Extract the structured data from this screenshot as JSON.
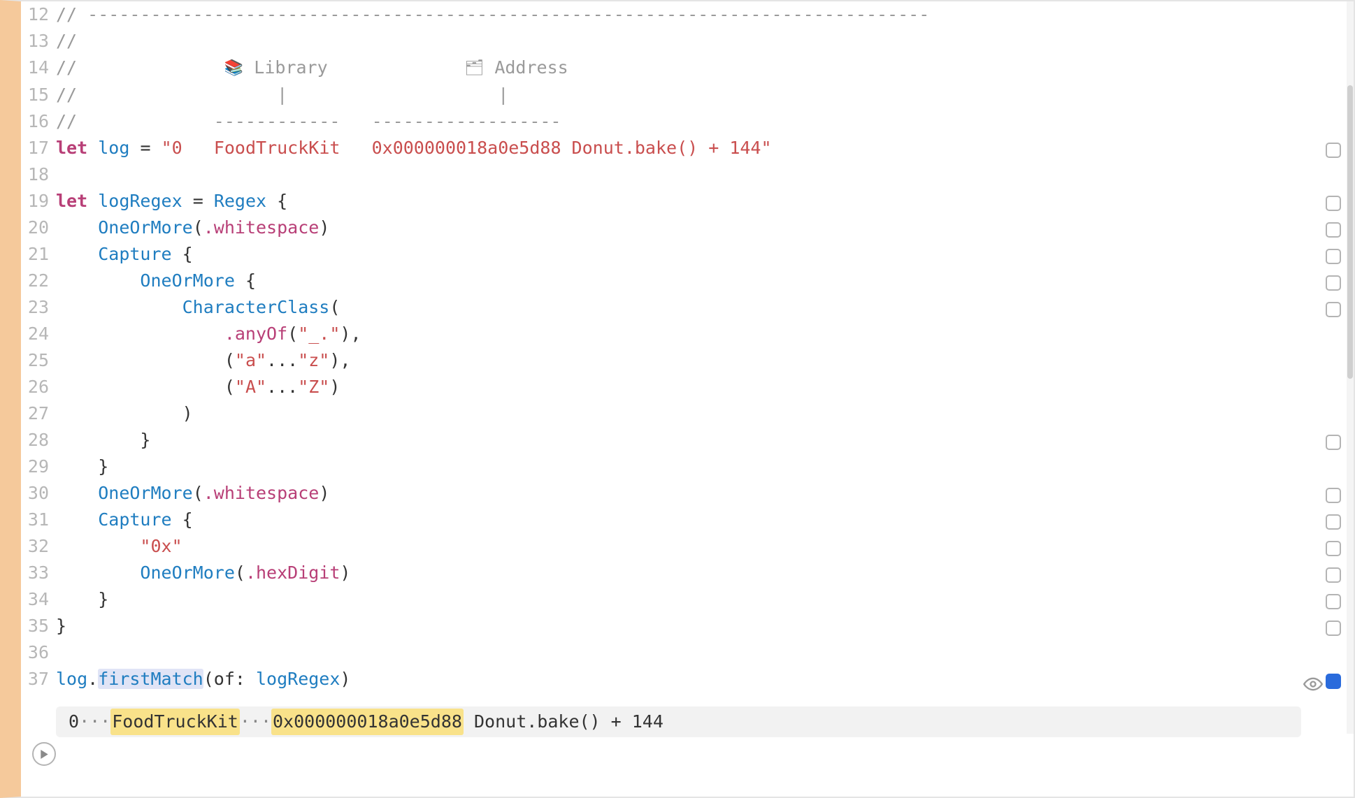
{
  "lines": {
    "12": {
      "n": "12",
      "comment_dashes": "// --------------------------------------------------------------------------------"
    },
    "13": {
      "n": "13",
      "slashes": "//"
    },
    "14": {
      "n": "14",
      "slashes": "//",
      "library_icon": "📚",
      "library": "Library",
      "address_icon": "🗂",
      "address": "Address"
    },
    "15": {
      "n": "15",
      "slashes": "//",
      "bar1": "|",
      "bar2": "|"
    },
    "16": {
      "n": "16",
      "slashes": "//",
      "dash1": "------------",
      "dash2": "------------------"
    },
    "17": {
      "n": "17",
      "let": "let",
      "name": "log",
      "eq": "=",
      "str": "\"0   FoodTruckKit   0x000000018a0e5d88 Donut.bake() + 144\""
    },
    "18": {
      "n": "18"
    },
    "19": {
      "n": "19",
      "let": "let",
      "name": "logRegex",
      "eq": "=",
      "type": "Regex",
      "brace": "{"
    },
    "20": {
      "n": "20",
      "fn": "OneOrMore",
      "open": "(",
      "member": ".whitespace",
      "close": ")"
    },
    "21": {
      "n": "21",
      "fn": "Capture",
      "brace": "{"
    },
    "22": {
      "n": "22",
      "fn": "OneOrMore",
      "brace": "{"
    },
    "23": {
      "n": "23",
      "fn": "CharacterClass",
      "open": "("
    },
    "24": {
      "n": "24",
      "member": ".anyOf",
      "open": "(",
      "str": "\"_.\"",
      "close": "),"
    },
    "25": {
      "n": "25",
      "open": "(",
      "s1": "\"a\"",
      "dots": "...",
      "s2": "\"z\"",
      "close": "),"
    },
    "26": {
      "n": "26",
      "open": "(",
      "s1": "\"A\"",
      "dots": "...",
      "s2": "\"Z\"",
      "close": ")"
    },
    "27": {
      "n": "27",
      "close": ")"
    },
    "28": {
      "n": "28",
      "brace": "}"
    },
    "29": {
      "n": "29",
      "brace": "}"
    },
    "30": {
      "n": "30",
      "fn": "OneOrMore",
      "open": "(",
      "member": ".whitespace",
      "close": ")"
    },
    "31": {
      "n": "31",
      "fn": "Capture",
      "brace": "{"
    },
    "32": {
      "n": "32",
      "str": "\"0x\""
    },
    "33": {
      "n": "33",
      "fn": "OneOrMore",
      "open": "(",
      "member": ".hexDigit",
      "close": ")"
    },
    "34": {
      "n": "34",
      "brace": "}"
    },
    "35": {
      "n": "35",
      "brace": "}"
    },
    "36": {
      "n": "36"
    },
    "37": {
      "n": "37",
      "ident": "log",
      "dot": ".",
      "method": "firstMatch",
      "sig": "(of: ",
      "arg": "logRegex",
      "close": ")"
    }
  },
  "result": {
    "zero": "0",
    "dots1": "···",
    "cap1": "FoodTruckKit",
    "dots2": "···",
    "cap2": "0x000000018a0e5d88",
    "rest": " Donut.bake() + 144"
  }
}
